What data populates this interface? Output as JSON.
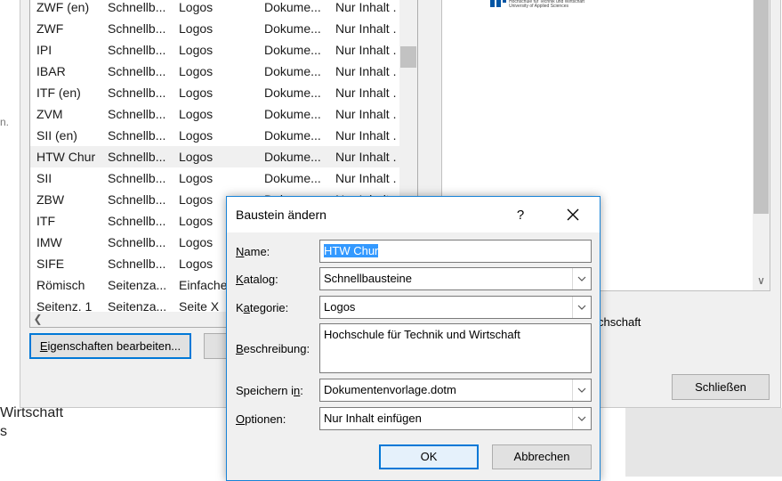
{
  "organizer": {
    "rows": [
      {
        "name": "ZWF (en)",
        "gallery": "Schnellb...",
        "category": "Logos",
        "template": "Dokume...",
        "behavior": "Nur Inhalt ."
      },
      {
        "name": "ZWF",
        "gallery": "Schnellb...",
        "category": "Logos",
        "template": "Dokume...",
        "behavior": "Nur Inhalt ."
      },
      {
        "name": "IPI",
        "gallery": "Schnellb...",
        "category": "Logos",
        "template": "Dokume...",
        "behavior": "Nur Inhalt ."
      },
      {
        "name": "IBAR",
        "gallery": "Schnellb...",
        "category": "Logos",
        "template": "Dokume...",
        "behavior": "Nur Inhalt ."
      },
      {
        "name": "ITF (en)",
        "gallery": "Schnellb...",
        "category": "Logos",
        "template": "Dokume...",
        "behavior": "Nur Inhalt ."
      },
      {
        "name": "ZVM",
        "gallery": "Schnellb...",
        "category": "Logos",
        "template": "Dokume...",
        "behavior": "Nur Inhalt ."
      },
      {
        "name": "SII (en)",
        "gallery": "Schnellb...",
        "category": "Logos",
        "template": "Dokume...",
        "behavior": "Nur Inhalt ."
      },
      {
        "name": "HTW Chur",
        "gallery": "Schnellb...",
        "category": "Logos",
        "template": "Dokume...",
        "behavior": "Nur Inhalt ."
      },
      {
        "name": "SII",
        "gallery": "Schnellb...",
        "category": "Logos",
        "template": "Dokume...",
        "behavior": "Nur Inhalt ."
      },
      {
        "name": "ZBW",
        "gallery": "Schnellb...",
        "category": "Logos",
        "template": "Doku...",
        "behavior": "Nur Inhalt ."
      },
      {
        "name": "ITF",
        "gallery": "Schnellb...",
        "category": "Logos",
        "template": "",
        "behavior": ""
      },
      {
        "name": "IMW",
        "gallery": "Schnellb...",
        "category": "Logos",
        "template": "",
        "behavior": ""
      },
      {
        "name": "SIFE",
        "gallery": "Schnellb...",
        "category": "Logos",
        "template": "",
        "behavior": ""
      },
      {
        "name": "Römisch",
        "gallery": "Seitenza...",
        "category": "Einfache",
        "template": "",
        "behavior": ""
      },
      {
        "name": "Seitenz. 1",
        "gallery": "Seitenza...",
        "category": "Seite X",
        "template": "",
        "behavior": ""
      }
    ],
    "edit_properties_button": "Eigenschaften bearbeiten...",
    "close_button": "Schließen",
    "description_partial": "chschaft",
    "preview_logo_text": "Hochschule für Technik und Wirtschaft University of Applied Sciences"
  },
  "background_doc": {
    "line1": "Wirtschaft",
    "line2": "s",
    "margin_char": "n."
  },
  "dialog": {
    "title": "Baustein ändern",
    "help": "?",
    "fields": {
      "name": {
        "label": "Name:",
        "value": "HTW Chur"
      },
      "katalog": {
        "label": "Katalog:",
        "value": "Schnellbausteine"
      },
      "kategorie": {
        "label": "Kategorie:",
        "value": "Logos"
      },
      "beschreibung": {
        "label": "Beschreibung:",
        "value": "Hochschule für Technik und Wirtschaft"
      },
      "speichern": {
        "label": "Speichern in:",
        "value": "Dokumentenvorlage.dotm"
      },
      "optionen": {
        "label": "Optionen:",
        "value": "Nur Inhalt einfügen"
      }
    },
    "ok_button": "OK",
    "cancel_button": "Abbrechen"
  },
  "colors": {
    "accent": "#0078d7",
    "selection": "#3399ff",
    "logo_blue": "#0055a4"
  }
}
